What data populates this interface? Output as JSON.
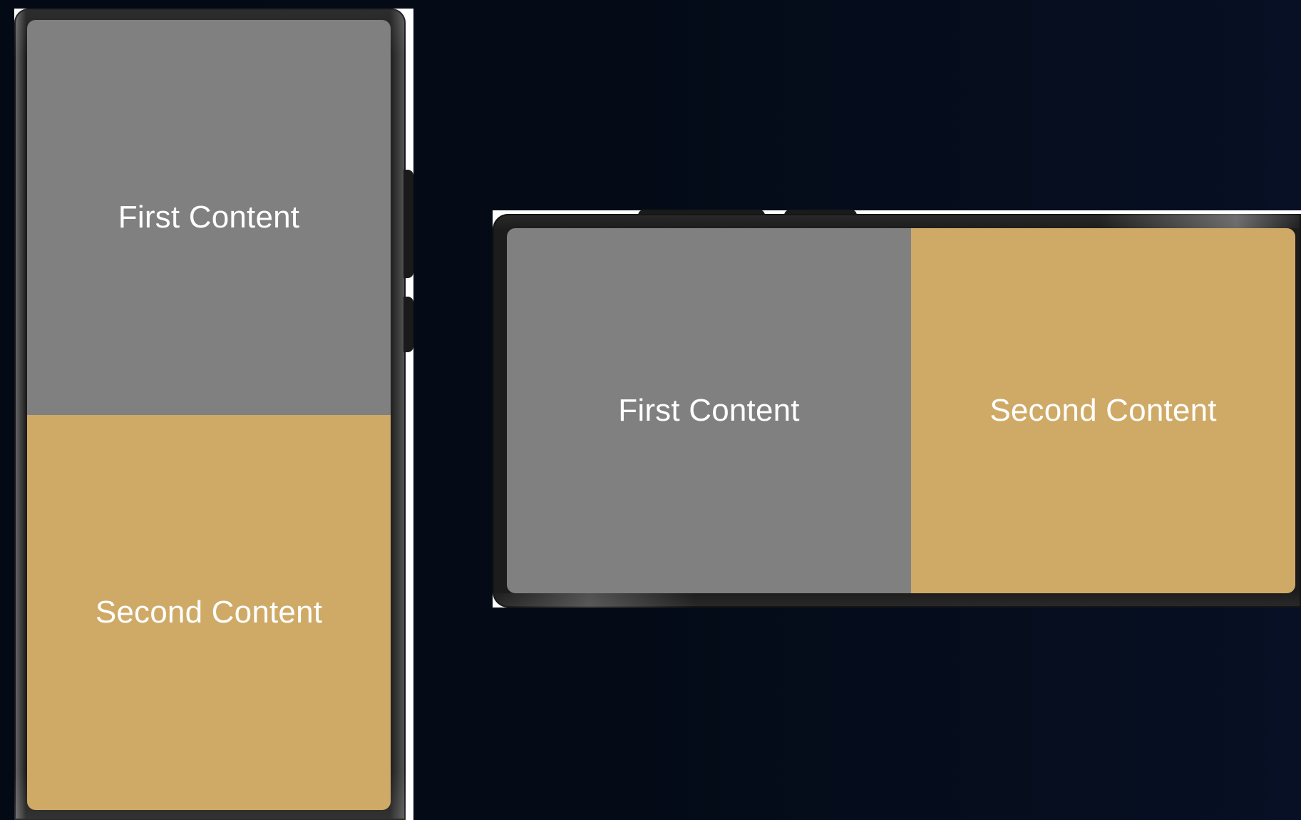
{
  "portrait_device": {
    "first_pane": {
      "label": "First Content",
      "color": "#808080"
    },
    "second_pane": {
      "label": "Second Content",
      "color": "#cfaa67"
    }
  },
  "landscape_device": {
    "first_pane": {
      "label": "First Content",
      "color": "#808080"
    },
    "second_pane": {
      "label": "Second Content",
      "color": "#cfaa67"
    }
  },
  "colors": {
    "background": "#040b17",
    "device_bezel": "#1c1c1c"
  }
}
